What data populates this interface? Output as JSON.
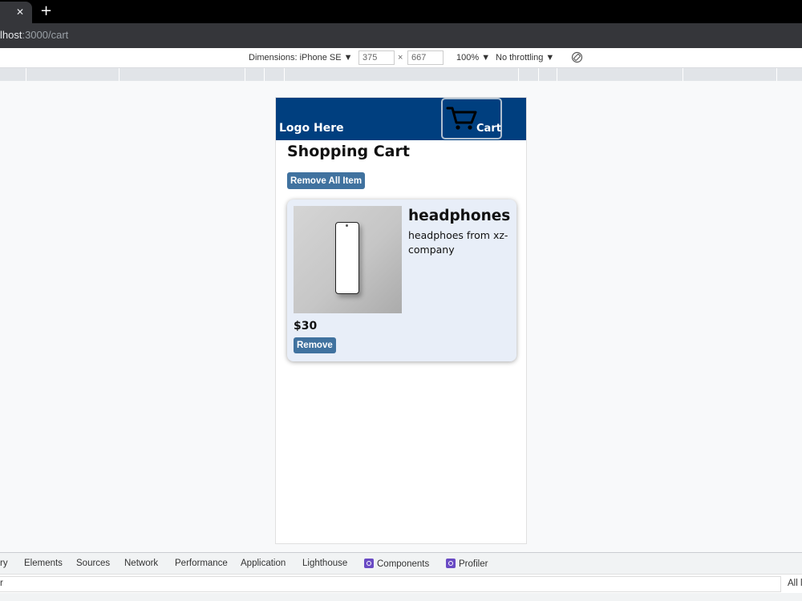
{
  "browser": {
    "tab_close": "✕",
    "new_tab": "+",
    "url_host": "lhost",
    "url_path": ":3000/cart"
  },
  "device_toolbar": {
    "dimensions_label": "Dimensions: iPhone SE ▼",
    "width": "375",
    "times": "×",
    "height": "667",
    "zoom": "100% ▼",
    "throttling": "No throttling ▼"
  },
  "site": {
    "logo": "Logo Here",
    "cart_label": "Cart",
    "page_title": "Shopping Cart",
    "remove_all_label": "Remove All Item",
    "items": [
      {
        "name": "headphones",
        "description": "headphoes from xz-company",
        "price": "$30",
        "remove_label": "Remove"
      }
    ]
  },
  "devtools": {
    "tabs": [
      "ry",
      "Elements",
      "Sources",
      "Network",
      "Performance",
      "Application",
      "Lighthouse",
      "Components",
      "Profiler"
    ],
    "filter_text": "r",
    "levels": "All l"
  },
  "colors": {
    "header_bg": "#003f7f",
    "button_bg": "#40729f",
    "card_bg": "#e8eef8",
    "react_icon": "#6a4bc4"
  }
}
